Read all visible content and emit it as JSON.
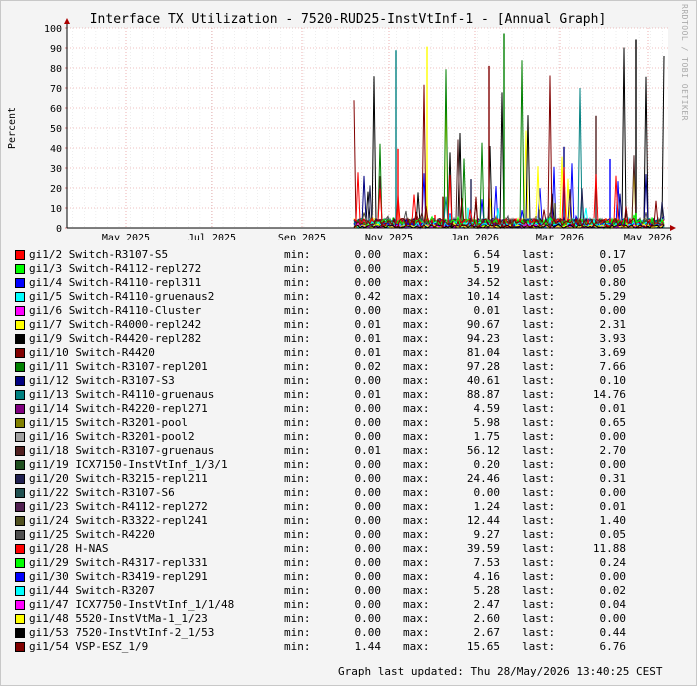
{
  "chart_data": {
    "type": "line",
    "title": "Interface TX Utilization - 7520-RUD25-InstVtInf-1 - [Annual Graph]",
    "ylabel": "Percent",
    "xlabel": "",
    "ylim": [
      0,
      100
    ],
    "yticks": [
      0,
      10,
      20,
      30,
      40,
      50,
      60,
      70,
      80,
      90,
      100
    ],
    "xticks": [
      "May 2025",
      "Jul 2025",
      "Sep 2025",
      "Nov 2025",
      "Jan 2026",
      "Mar 2026",
      "May 2026"
    ],
    "grid": true,
    "legend_headers": {
      "min": "min:",
      "max": "max:",
      "last": "last:"
    },
    "series": [
      {
        "port": "gi1/2",
        "name": "Switch-R3107-S5",
        "color": "#ff0000",
        "min": "0.00",
        "max": "6.54",
        "last": "0.17"
      },
      {
        "port": "gi1/3",
        "name": "Switch-R4112-repl272",
        "color": "#00ff00",
        "min": "0.00",
        "max": "5.19",
        "last": "0.05"
      },
      {
        "port": "gi1/4",
        "name": "Switch-R4110-repl311",
        "color": "#0000ff",
        "min": "0.00",
        "max": "34.52",
        "last": "0.80"
      },
      {
        "port": "gi1/5",
        "name": "Switch-R4110-gruenaus2",
        "color": "#00ffff",
        "min": "0.42",
        "max": "10.14",
        "last": "5.29"
      },
      {
        "port": "gi1/6",
        "name": "Switch-R4110-Cluster",
        "color": "#ff00ff",
        "min": "0.00",
        "max": "0.01",
        "last": "0.00"
      },
      {
        "port": "gi1/7",
        "name": "Switch-R4000-repl242",
        "color": "#ffff00",
        "min": "0.01",
        "max": "90.67",
        "last": "2.31"
      },
      {
        "port": "gi1/9",
        "name": "Switch-R4420-repl282",
        "color": "#000000",
        "min": "0.01",
        "max": "94.23",
        "last": "3.93"
      },
      {
        "port": "gi1/10",
        "name": "Switch-R4420",
        "color": "#800000",
        "min": "0.01",
        "max": "81.04",
        "last": "3.69"
      },
      {
        "port": "gi1/11",
        "name": "Switch-R3107-repl201",
        "color": "#008000",
        "min": "0.02",
        "max": "97.28",
        "last": "7.66"
      },
      {
        "port": "gi1/12",
        "name": "Switch-R3107-S3",
        "color": "#000080",
        "min": "0.00",
        "max": "40.61",
        "last": "0.10"
      },
      {
        "port": "gi1/13",
        "name": "Switch-R4110-gruenaus",
        "color": "#008080",
        "min": "0.01",
        "max": "88.87",
        "last": "14.76"
      },
      {
        "port": "gi1/14",
        "name": "Switch-R4220-repl271",
        "color": "#800080",
        "min": "0.00",
        "max": "4.59",
        "last": "0.01"
      },
      {
        "port": "gi1/15",
        "name": "Switch-R3201-pool",
        "color": "#808000",
        "min": "0.00",
        "max": "5.98",
        "last": "0.65"
      },
      {
        "port": "gi1/16",
        "name": "Switch-R3201-pool2",
        "color": "#a0a0a0",
        "min": "0.00",
        "max": "1.75",
        "last": "0.00"
      },
      {
        "port": "gi1/18",
        "name": "Switch-R3107-gruenaus",
        "color": "#502020",
        "min": "0.01",
        "max": "56.12",
        "last": "2.70"
      },
      {
        "port": "gi1/19",
        "name": "ICX7150-InstVtInf_1/3/1",
        "color": "#205020",
        "min": "0.00",
        "max": "0.20",
        "last": "0.00"
      },
      {
        "port": "gi1/20",
        "name": "Switch-R3215-repl211",
        "color": "#202050",
        "min": "0.00",
        "max": "24.46",
        "last": "0.31"
      },
      {
        "port": "gi1/22",
        "name": "Switch-R3107-S6",
        "color": "#205050",
        "min": "0.00",
        "max": "0.00",
        "last": "0.00"
      },
      {
        "port": "gi1/23",
        "name": "Switch-R4112-repl272",
        "color": "#502050",
        "min": "0.00",
        "max": "1.24",
        "last": "0.01"
      },
      {
        "port": "gi1/24",
        "name": "Switch-R3322-repl241",
        "color": "#505020",
        "min": "0.00",
        "max": "12.44",
        "last": "1.40"
      },
      {
        "port": "gi1/25",
        "name": "Switch-R4220",
        "color": "#505050",
        "min": "0.00",
        "max": "9.27",
        "last": "0.05"
      },
      {
        "port": "gi1/28",
        "name": "H-NAS",
        "color": "#ff0000",
        "min": "0.00",
        "max": "39.59",
        "last": "11.88"
      },
      {
        "port": "gi1/29",
        "name": "Switch-R4317-repl331",
        "color": "#00ff00",
        "min": "0.00",
        "max": "7.53",
        "last": "0.24"
      },
      {
        "port": "gi1/30",
        "name": "Switch-R3419-repl291",
        "color": "#0000ff",
        "min": "0.00",
        "max": "4.16",
        "last": "0.00"
      },
      {
        "port": "gi1/44",
        "name": "Switch-R3207",
        "color": "#00ffff",
        "min": "0.00",
        "max": "5.28",
        "last": "0.02"
      },
      {
        "port": "gi1/47",
        "name": "ICX7750-InstVtInf_1/1/48",
        "color": "#ff00ff",
        "min": "0.00",
        "max": "2.47",
        "last": "0.04"
      },
      {
        "port": "gi1/48",
        "name": "5520-InstVtMa-1_1/23",
        "color": "#ffff00",
        "min": "0.00",
        "max": "2.60",
        "last": "0.00"
      },
      {
        "port": "gi1/53",
        "name": "7520-InstVtInf-2_1/53",
        "color": "#000000",
        "min": "0.00",
        "max": "2.67",
        "last": "0.44"
      },
      {
        "port": "gi1/54",
        "name": "VSP-ESZ_1/9",
        "color": "#800000",
        "min": "1.44",
        "max": "15.65",
        "last": "6.76"
      }
    ]
  },
  "footer": "Graph last updated: Thu 28/May/2026 13:40:25 CEST",
  "watermark": "RRDTOOL / TOBI OETIKER"
}
